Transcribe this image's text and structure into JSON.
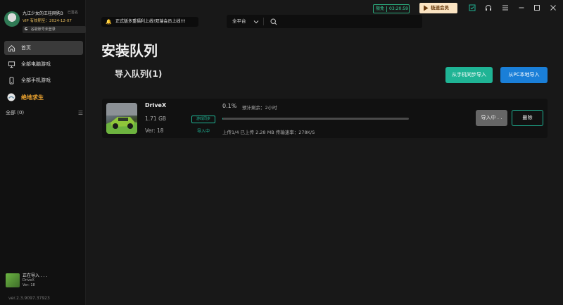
{
  "profile": {
    "name": "九江少女的王桂网购3",
    "tag": "已签名",
    "vip_text": "VIP 有效期至：2024-12-07",
    "login_prefix": "G",
    "login_text": "谷歌账号未登录"
  },
  "sidebar": {
    "items": [
      {
        "label": "首页",
        "icon": "home-icon"
      },
      {
        "label": "全部电脑游戏",
        "icon": "monitor-icon"
      },
      {
        "label": "全部手机游戏",
        "icon": "phone-icon"
      },
      {
        "label": "绝地求生",
        "icon": "game-icon"
      }
    ],
    "all_label": "全部 (0)",
    "list_icon": "list-icon"
  },
  "bottom_task": {
    "status": "正在导入 . . .",
    "name": "DriveX",
    "ver": "Ver: 18"
  },
  "version": "ver.2.3.9097.37923",
  "topbar": {
    "notice": "正式版多重福利上线!双端会员上线!!!",
    "platform": "全平台",
    "speed_label": "限免",
    "speed_time": "03:20:59",
    "vip_button": "极速会员"
  },
  "main": {
    "page_title": "安装队列",
    "queue_title": "导入队列(1)",
    "btn_phone": "从手机同步导入",
    "btn_pc": "从PC本地导入"
  },
  "task": {
    "name": "DriveX",
    "size": "1.71 GB",
    "ver": "Ver: 18",
    "sync_tag": "游戏同步",
    "status": "导入中",
    "percent_text": "0.1%",
    "remain": "预计剩余：2小时",
    "progress": 0.1,
    "upload_info": "上传1/4 已上传 2.28 MB   传输速率：278K/S",
    "btn_importing": "导入中 . .",
    "btn_delete": "删除"
  },
  "colors": {
    "accent_green": "#1fb495",
    "accent_blue": "#1a7fd8",
    "game_orange": "#f0a630",
    "vip_gold": "#e2b85a"
  }
}
